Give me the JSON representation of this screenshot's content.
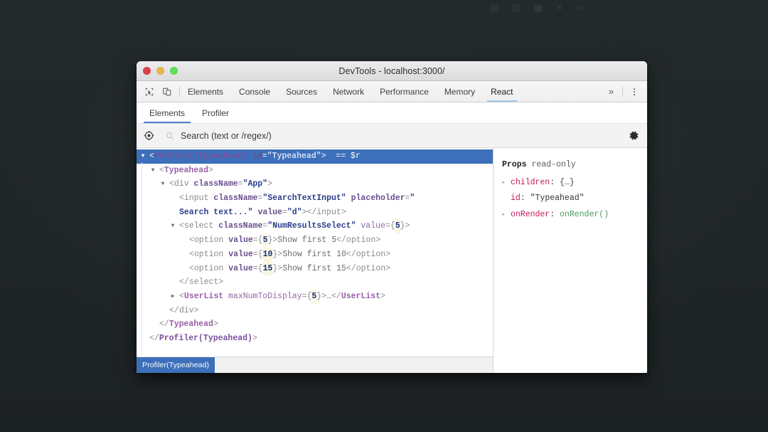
{
  "window": {
    "title": "DevTools - localhost:3000/",
    "traffic_lights": [
      "close",
      "minimize",
      "maximize"
    ]
  },
  "toolbar": {
    "icons": [
      "inspect-element-icon",
      "device-toolbar-icon"
    ],
    "tabs": [
      {
        "label": "Elements",
        "active": false
      },
      {
        "label": "Console",
        "active": false
      },
      {
        "label": "Sources",
        "active": false
      },
      {
        "label": "Network",
        "active": false
      },
      {
        "label": "Performance",
        "active": false
      },
      {
        "label": "Memory",
        "active": false
      },
      {
        "label": "React",
        "active": true
      }
    ],
    "overflow_label": "»",
    "kebab_label": "more-options"
  },
  "subtabs": [
    {
      "label": "Elements",
      "active": true
    },
    {
      "label": "Profiler",
      "active": false
    }
  ],
  "search": {
    "placeholder": "Search (text or /regex/)",
    "value": "",
    "target_icon": "inspect-target-icon",
    "search_icon": "search-icon",
    "gear_icon": "gear-icon"
  },
  "tree": [
    {
      "id": "row-profiler-open",
      "indent": 0,
      "arrow": "open",
      "selected": true,
      "tokens": [
        {
          "t": "punc",
          "s": "<"
        },
        {
          "t": "compb",
          "s": "Profiler(Typeahead)"
        },
        {
          "t": "text",
          "s": " "
        },
        {
          "t": "attrb",
          "s": "id"
        },
        {
          "t": "punc",
          "s": "="
        },
        {
          "t": "val",
          "s": "\"Typeahead\""
        },
        {
          "t": "punc",
          "s": ">"
        },
        {
          "t": "text",
          "s": "  "
        },
        {
          "t": "dollar",
          "s": "== $r"
        }
      ]
    },
    {
      "id": "row-typeahead-open",
      "indent": 1,
      "arrow": "open",
      "selected": false,
      "tokens": [
        {
          "t": "punc",
          "s": "<"
        },
        {
          "t": "comp",
          "s": "Typeahead"
        },
        {
          "t": "punc",
          "s": ">"
        }
      ]
    },
    {
      "id": "row-div-open",
      "indent": 2,
      "arrow": "open",
      "selected": false,
      "tokens": [
        {
          "t": "punc",
          "s": "<"
        },
        {
          "t": "tag",
          "s": "div"
        },
        {
          "t": "text",
          "s": " "
        },
        {
          "t": "attrb",
          "s": "className"
        },
        {
          "t": "punc",
          "s": "="
        },
        {
          "t": "val",
          "s": "\"App\""
        },
        {
          "t": "punc",
          "s": ">"
        }
      ]
    },
    {
      "id": "row-input",
      "indent": 3,
      "arrow": "none",
      "selected": false,
      "wrap": true,
      "tokens": [
        {
          "t": "punc",
          "s": "<"
        },
        {
          "t": "tag",
          "s": "input"
        },
        {
          "t": "text",
          "s": " "
        },
        {
          "t": "attrb",
          "s": "className"
        },
        {
          "t": "punc",
          "s": "="
        },
        {
          "t": "val",
          "s": "\"SearchTextInput\""
        },
        {
          "t": "text",
          "s": " "
        },
        {
          "t": "attrb",
          "s": "placeholder"
        },
        {
          "t": "punc",
          "s": "="
        },
        {
          "t": "val",
          "s": "\""
        },
        {
          "t": "br",
          "s": ""
        },
        {
          "t": "val",
          "s": "Search text...\""
        },
        {
          "t": "text",
          "s": " "
        },
        {
          "t": "attrb",
          "s": "value"
        },
        {
          "t": "punc",
          "s": "="
        },
        {
          "t": "val",
          "s": "\"d\""
        },
        {
          "t": "punc",
          "s": ">"
        },
        {
          "t": "punc",
          "s": "</"
        },
        {
          "t": "tag",
          "s": "input"
        },
        {
          "t": "punc",
          "s": ">"
        }
      ]
    },
    {
      "id": "row-select-open",
      "indent": 3,
      "arrow": "open",
      "selected": false,
      "tokens": [
        {
          "t": "punc",
          "s": "<"
        },
        {
          "t": "tag",
          "s": "select"
        },
        {
          "t": "text",
          "s": " "
        },
        {
          "t": "attrb",
          "s": "className"
        },
        {
          "t": "punc",
          "s": "="
        },
        {
          "t": "val",
          "s": "\"NumResultsSelect\""
        },
        {
          "t": "text",
          "s": " "
        },
        {
          "t": "attr",
          "s": "value"
        },
        {
          "t": "punc",
          "s": "={"
        },
        {
          "t": "num",
          "s": "5"
        },
        {
          "t": "punc",
          "s": "}>"
        }
      ]
    },
    {
      "id": "row-option-5",
      "indent": 4,
      "arrow": "none",
      "selected": false,
      "tokens": [
        {
          "t": "punc",
          "s": "<"
        },
        {
          "t": "tag",
          "s": "option"
        },
        {
          "t": "text",
          "s": " "
        },
        {
          "t": "attrb",
          "s": "value"
        },
        {
          "t": "punc",
          "s": "={"
        },
        {
          "t": "num",
          "s": "5"
        },
        {
          "t": "punc",
          "s": "}>"
        },
        {
          "t": "text",
          "s": "Show first 5"
        },
        {
          "t": "punc",
          "s": "</"
        },
        {
          "t": "tag",
          "s": "option"
        },
        {
          "t": "punc",
          "s": ">"
        }
      ]
    },
    {
      "id": "row-option-10",
      "indent": 4,
      "arrow": "none",
      "selected": false,
      "tokens": [
        {
          "t": "punc",
          "s": "<"
        },
        {
          "t": "tag",
          "s": "option"
        },
        {
          "t": "text",
          "s": " "
        },
        {
          "t": "attrb",
          "s": "value"
        },
        {
          "t": "punc",
          "s": "={"
        },
        {
          "t": "num",
          "s": "10"
        },
        {
          "t": "punc",
          "s": "}>"
        },
        {
          "t": "text",
          "s": "Show first 10"
        },
        {
          "t": "punc",
          "s": "</"
        },
        {
          "t": "tag",
          "s": "option"
        },
        {
          "t": "punc",
          "s": ">"
        }
      ]
    },
    {
      "id": "row-option-15",
      "indent": 4,
      "arrow": "none",
      "selected": false,
      "tokens": [
        {
          "t": "punc",
          "s": "<"
        },
        {
          "t": "tag",
          "s": "option"
        },
        {
          "t": "text",
          "s": " "
        },
        {
          "t": "attrb",
          "s": "value"
        },
        {
          "t": "punc",
          "s": "={"
        },
        {
          "t": "num",
          "s": "15"
        },
        {
          "t": "punc",
          "s": "}>"
        },
        {
          "t": "text",
          "s": "Show first 15"
        },
        {
          "t": "punc",
          "s": "</"
        },
        {
          "t": "tag",
          "s": "option"
        },
        {
          "t": "punc",
          "s": ">"
        }
      ]
    },
    {
      "id": "row-select-close",
      "indent": 3,
      "arrow": "none",
      "selected": false,
      "tokens": [
        {
          "t": "punc",
          "s": "</"
        },
        {
          "t": "tag",
          "s": "select"
        },
        {
          "t": "punc",
          "s": ">"
        }
      ]
    },
    {
      "id": "row-userlist",
      "indent": 3,
      "arrow": "closed",
      "selected": false,
      "tokens": [
        {
          "t": "punc",
          "s": "<"
        },
        {
          "t": "comp",
          "s": "UserList"
        },
        {
          "t": "text",
          "s": " "
        },
        {
          "t": "attr",
          "s": "maxNumToDisplay"
        },
        {
          "t": "punc",
          "s": "={"
        },
        {
          "t": "num",
          "s": "5"
        },
        {
          "t": "punc",
          "s": "}>"
        },
        {
          "t": "text",
          "s": "…"
        },
        {
          "t": "punc",
          "s": "</"
        },
        {
          "t": "comp",
          "s": "UserList"
        },
        {
          "t": "punc",
          "s": ">"
        }
      ]
    },
    {
      "id": "row-div-close",
      "indent": 2,
      "arrow": "none",
      "selected": false,
      "tokens": [
        {
          "t": "punc",
          "s": "</"
        },
        {
          "t": "tag",
          "s": "div"
        },
        {
          "t": "punc",
          "s": ">"
        }
      ]
    },
    {
      "id": "row-typeahead-close",
      "indent": 1,
      "arrow": "none",
      "selected": false,
      "tokens": [
        {
          "t": "punc",
          "s": "</"
        },
        {
          "t": "comp",
          "s": "Typeahead"
        },
        {
          "t": "punc",
          "s": ">"
        }
      ]
    },
    {
      "id": "row-profiler-close",
      "indent": 0,
      "arrow": "none",
      "selected": false,
      "tokens": [
        {
          "t": "punc",
          "s": "</"
        },
        {
          "t": "compb",
          "s": "Profiler(Typeahead)"
        },
        {
          "t": "punc",
          "s": ">"
        }
      ]
    }
  ],
  "breadcrumb": {
    "items": [
      {
        "label": "Profiler(Typeahead)",
        "selected": true
      }
    ]
  },
  "props": {
    "title": "Props",
    "subtitle": "read-only",
    "rows": [
      {
        "arrow": "closed",
        "key": "children",
        "sep": ": ",
        "value": "{…}",
        "value_kind": "obj"
      },
      {
        "arrow": "none",
        "key": "id",
        "sep": ": ",
        "value": "\"Typeahead\"",
        "value_kind": "str"
      },
      {
        "arrow": "closed",
        "key": "onRender",
        "sep": ": ",
        "value": "onRender()",
        "value_kind": "fn"
      }
    ]
  },
  "colors": {
    "selection_blue": "#3d6fba",
    "accent_underline": "#4a7fd0",
    "devtools_tab_underline": "#9fc6ec",
    "prop_key": "#c2185b",
    "prop_fn": "#4a9a5a",
    "component_purple": "#9a5fa8",
    "attr_value_blue": "#2b3e8c",
    "page_background": "#22272a"
  }
}
